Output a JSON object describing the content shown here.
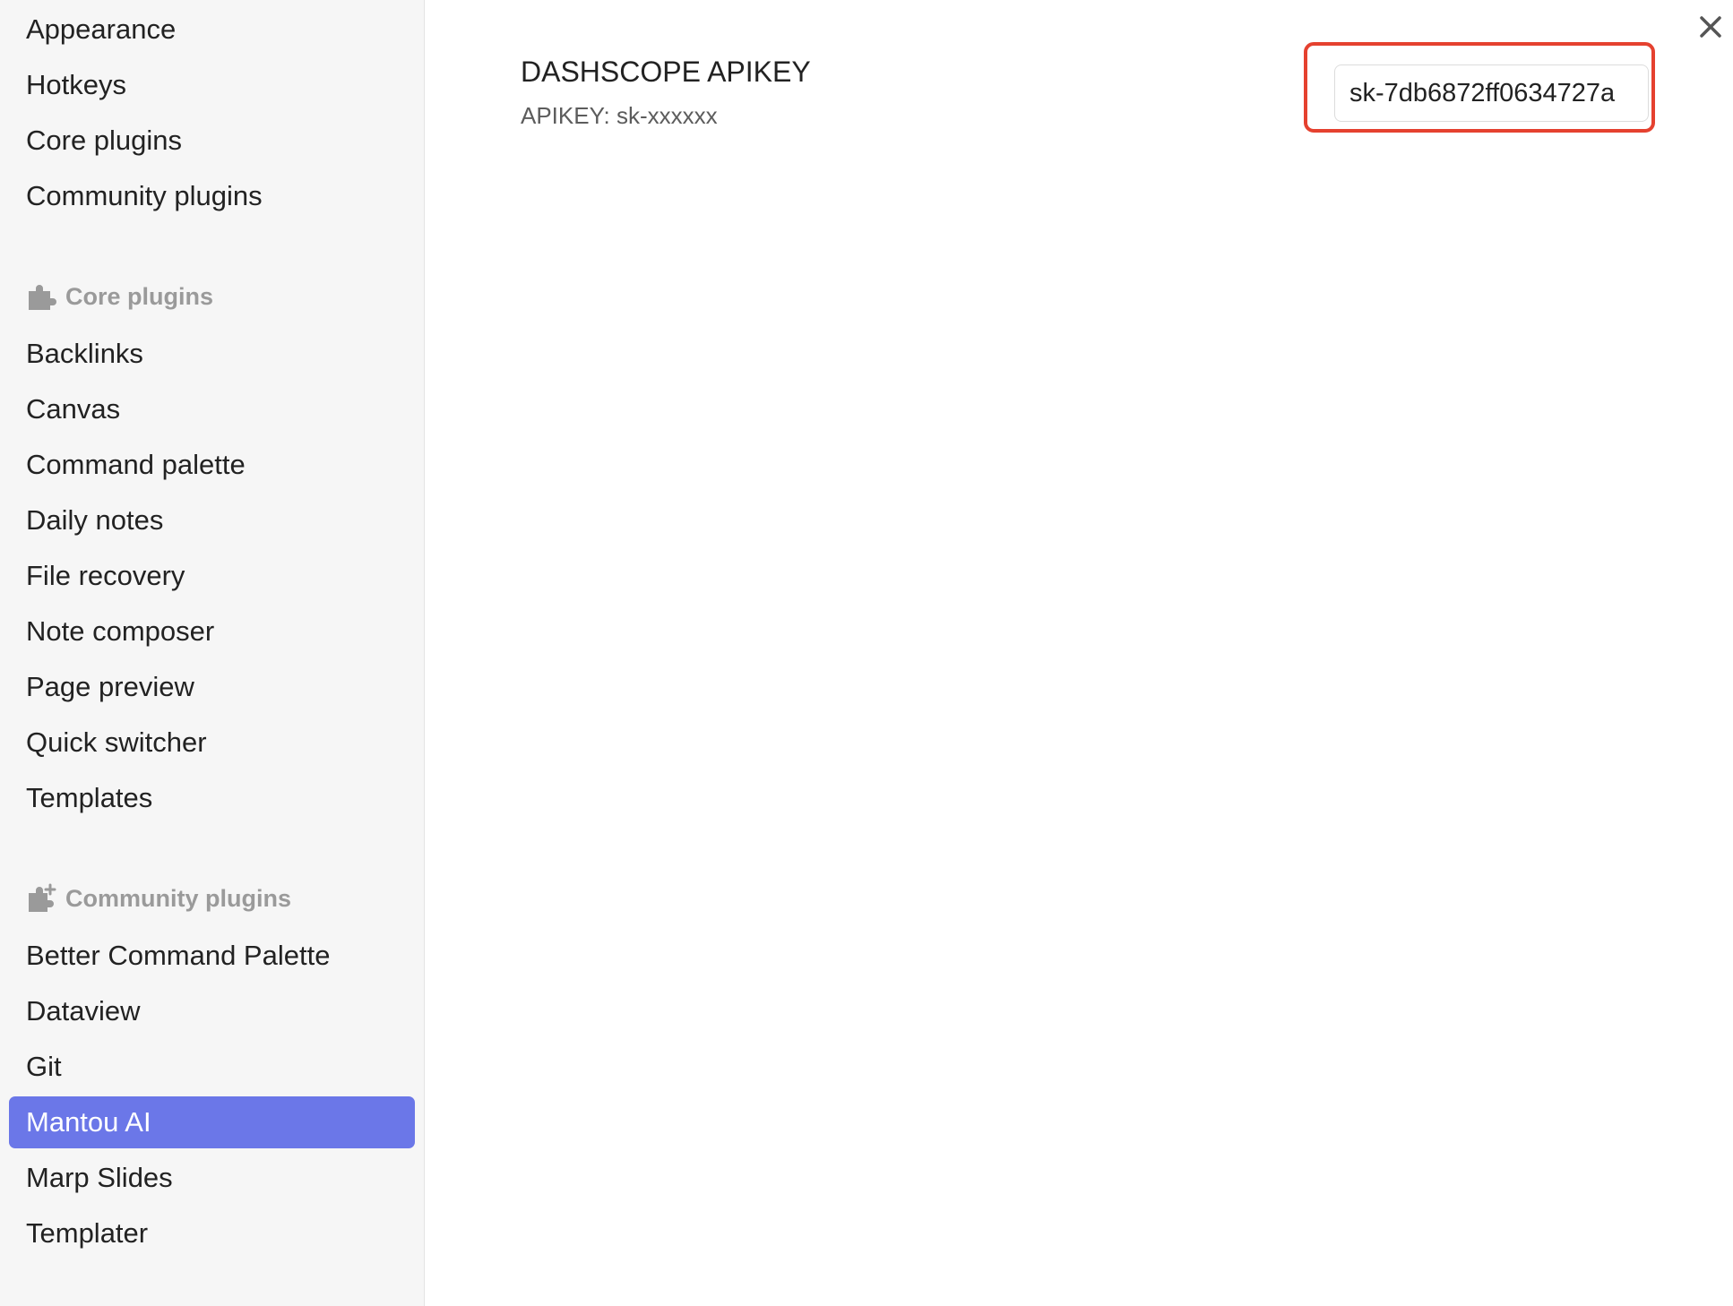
{
  "sidebar": {
    "top_items": [
      {
        "label": "Appearance"
      },
      {
        "label": "Hotkeys"
      },
      {
        "label": "Core plugins"
      },
      {
        "label": "Community plugins"
      }
    ],
    "core_section": {
      "heading": "Core plugins",
      "icon": "puzzle-icon",
      "items": [
        {
          "label": "Backlinks"
        },
        {
          "label": "Canvas"
        },
        {
          "label": "Command palette"
        },
        {
          "label": "Daily notes"
        },
        {
          "label": "File recovery"
        },
        {
          "label": "Note composer"
        },
        {
          "label": "Page preview"
        },
        {
          "label": "Quick switcher"
        },
        {
          "label": "Templates"
        }
      ]
    },
    "community_section": {
      "heading": "Community plugins",
      "icon": "puzzle-plus-icon",
      "items": [
        {
          "label": "Better Command Palette"
        },
        {
          "label": "Dataview"
        },
        {
          "label": "Git"
        },
        {
          "label": "Mantou AI",
          "active": true
        },
        {
          "label": "Marp Slides"
        },
        {
          "label": "Templater"
        }
      ]
    }
  },
  "main": {
    "setting": {
      "name": "DASHSCOPE APIKEY",
      "description": "APIKEY: sk-xxxxxx",
      "value": "sk-7db6872ff0634727a"
    },
    "close_icon": "close-icon"
  },
  "colors": {
    "sidebar_bg": "#f6f6f6",
    "accent": "#6b77e8",
    "highlight_border": "#e5412f",
    "muted_text": "#9a9a9a"
  }
}
